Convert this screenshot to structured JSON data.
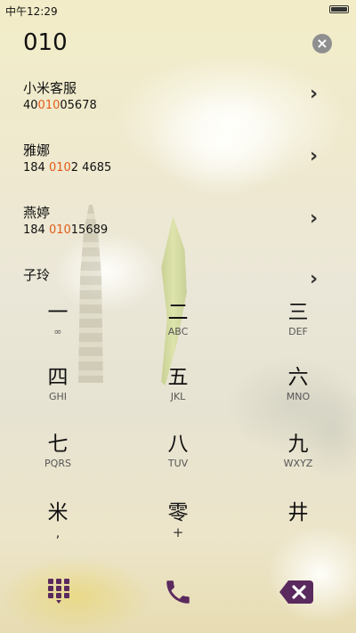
{
  "status": {
    "time": "中午12:29"
  },
  "dial": {
    "input": "010",
    "clear_symbol": "×"
  },
  "contacts": [
    {
      "name": "小米客服",
      "num_pre": "40",
      "num_hl": "010",
      "num_post": "05678"
    },
    {
      "name": "雅娜",
      "num_pre": "184 ",
      "num_hl": "010",
      "num_post": "2 4685"
    },
    {
      "name": "燕婷",
      "num_pre": "184 ",
      "num_hl": "010",
      "num_post": "15689"
    },
    {
      "name": "子玲",
      "num_pre": "",
      "num_hl": "",
      "num_post": ""
    }
  ],
  "keys": [
    {
      "main": "一",
      "sub": "∞"
    },
    {
      "main": "二",
      "sub": "ABC"
    },
    {
      "main": "三",
      "sub": "DEF"
    },
    {
      "main": "四",
      "sub": "GHI"
    },
    {
      "main": "五",
      "sub": "JKL"
    },
    {
      "main": "六",
      "sub": "MNO"
    },
    {
      "main": "七",
      "sub": "PQRS"
    },
    {
      "main": "八",
      "sub": "TUV"
    },
    {
      "main": "九",
      "sub": "WXYZ"
    },
    {
      "main": "米",
      "sub": ","
    },
    {
      "main": "零",
      "sub": "+"
    },
    {
      "main": "井",
      "sub": ""
    }
  ],
  "colors": {
    "accent": "#5a2a5e",
    "highlight": "#e35b1a"
  },
  "icons": {
    "chevron": "›",
    "dialpad": "dialpad-icon",
    "call": "phone-icon",
    "delete": "backspace-icon"
  }
}
